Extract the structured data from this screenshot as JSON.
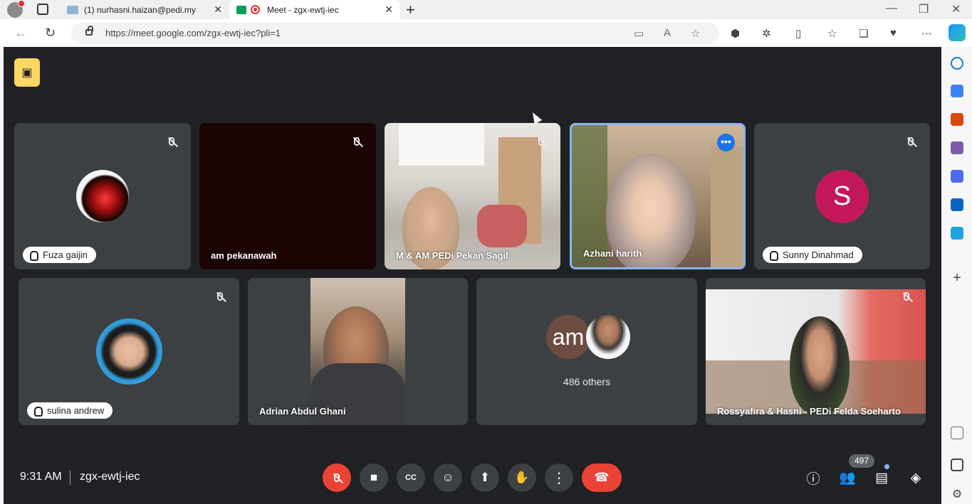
{
  "browser": {
    "tabs": [
      {
        "title": "(1) nurhasni.haizan@pedi.my",
        "active": false
      },
      {
        "title": "Meet - zgx-ewtj-iec",
        "active": true
      }
    ],
    "url": "https://meet.google.com/zgx-ewtj-iec?pli=1"
  },
  "meet": {
    "participants_row1": [
      {
        "name": "Fuza gaijin",
        "muted": true,
        "label_style": "chip"
      },
      {
        "name": "am pekanawah",
        "muted": true,
        "label_style": "plain"
      },
      {
        "name": "M & AM PEDi Pekan Sagil",
        "muted": true,
        "label_style": "plain"
      },
      {
        "name": "Azhani harith",
        "muted": false,
        "label_style": "plain",
        "speaking": true
      },
      {
        "name": "Sunny Dinahmad",
        "muted": true,
        "label_style": "chip",
        "avatar_letter": "S",
        "avatar_color": "#c2185b"
      }
    ],
    "participants_row2": [
      {
        "name": "sulina andrew",
        "muted": true,
        "label_style": "chip"
      },
      {
        "name": "Adrian Abdul Ghani",
        "muted": false,
        "label_style": "plain"
      },
      {
        "name": "486 others",
        "avatar_initials": "am"
      },
      {
        "name": "Rossyafira & Hasni - PEDi Felda Soeharto",
        "muted": true,
        "label_style": "plain"
      }
    ],
    "footer": {
      "time": "9:31 AM",
      "meeting_code": "zgx-ewtj-iec",
      "participant_count": "497"
    },
    "colors": {
      "background": "#202124",
      "tile": "#3c4043",
      "hangup": "#ea4335",
      "speaking_border": "#8ab4f8",
      "recording_badge": "#fdd663"
    }
  },
  "icons": {
    "recording_badge": "recording-icon",
    "mic": "mic-off-icon",
    "camera": "camera-icon",
    "captions": "captions-icon",
    "emoji": "emoji-icon",
    "present": "present-icon",
    "hand": "raise-hand-icon",
    "more": "more-options-icon",
    "end_call": "end-call-icon",
    "info": "info-icon",
    "people": "people-icon",
    "chat": "chat-icon",
    "activities": "activities-icon"
  }
}
